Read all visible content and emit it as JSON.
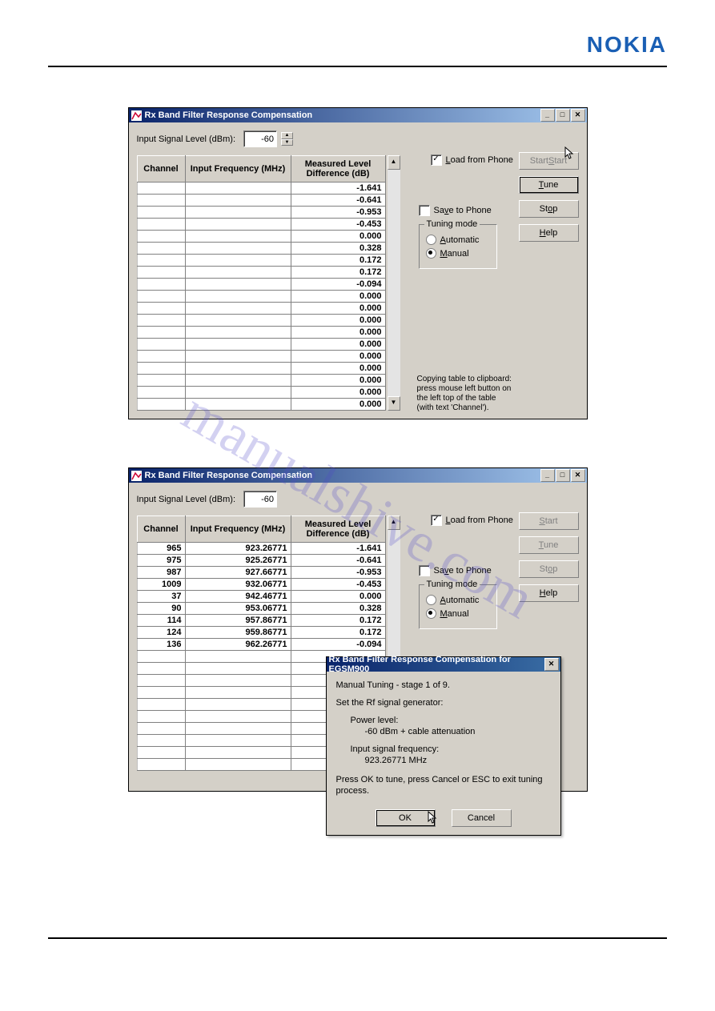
{
  "logo_text": "NOKIA",
  "watermark": "manualshive.com",
  "window_title": "Rx Band Filter Response Compensation",
  "input_signal_label": "Input Signal Level (dBm):",
  "input_signal_value": "-60",
  "cols": {
    "channel": "Channel",
    "freq": "Input Frequency (MHz)",
    "diff": "Measured Level\nDifference (dB)"
  },
  "load_label": "Load from Phone",
  "save_label": "Save to Phone",
  "load_checked": true,
  "save_checked": false,
  "tuning_legend": "Tuning mode",
  "tuning_auto": "Automatic",
  "tuning_manual": "Manual",
  "buttons": {
    "start": "Start",
    "tune": "Tune",
    "stop": "Stop",
    "help": "Help"
  },
  "copy_hint": "Copying table to clipboard: press mouse left button on the left top of the table (with text 'Channel').",
  "screenshot1_rows": [
    {
      "channel": "",
      "freq": "",
      "diff": "-1.641"
    },
    {
      "channel": "",
      "freq": "",
      "diff": "-0.641"
    },
    {
      "channel": "",
      "freq": "",
      "diff": "-0.953"
    },
    {
      "channel": "",
      "freq": "",
      "diff": "-0.453"
    },
    {
      "channel": "",
      "freq": "",
      "diff": "0.000"
    },
    {
      "channel": "",
      "freq": "",
      "diff": "0.328"
    },
    {
      "channel": "",
      "freq": "",
      "diff": "0.172"
    },
    {
      "channel": "",
      "freq": "",
      "diff": "0.172"
    },
    {
      "channel": "",
      "freq": "",
      "diff": "-0.094"
    },
    {
      "channel": "",
      "freq": "",
      "diff": "0.000"
    },
    {
      "channel": "",
      "freq": "",
      "diff": "0.000"
    },
    {
      "channel": "",
      "freq": "",
      "diff": "0.000"
    },
    {
      "channel": "",
      "freq": "",
      "diff": "0.000"
    },
    {
      "channel": "",
      "freq": "",
      "diff": "0.000"
    },
    {
      "channel": "",
      "freq": "",
      "diff": "0.000"
    },
    {
      "channel": "",
      "freq": "",
      "diff": "0.000"
    },
    {
      "channel": "",
      "freq": "",
      "diff": "0.000"
    },
    {
      "channel": "",
      "freq": "",
      "diff": "0.000"
    },
    {
      "channel": "",
      "freq": "",
      "diff": "0.000"
    }
  ],
  "screenshot2_rows": [
    {
      "channel": "965",
      "freq": "923.26771",
      "diff": "-1.641"
    },
    {
      "channel": "975",
      "freq": "925.26771",
      "diff": "-0.641"
    },
    {
      "channel": "987",
      "freq": "927.66771",
      "diff": "-0.953"
    },
    {
      "channel": "1009",
      "freq": "932.06771",
      "diff": "-0.453"
    },
    {
      "channel": "37",
      "freq": "942.46771",
      "diff": "0.000"
    },
    {
      "channel": "90",
      "freq": "953.06771",
      "diff": "0.328"
    },
    {
      "channel": "114",
      "freq": "957.86771",
      "diff": "0.172"
    },
    {
      "channel": "124",
      "freq": "959.86771",
      "diff": "0.172"
    },
    {
      "channel": "136",
      "freq": "962.26771",
      "diff": "-0.094"
    }
  ],
  "modal": {
    "title": "Rx Band Filter Response Compensation for EGSM900",
    "stage": "Manual Tuning - stage 1 of 9.",
    "set_gen": "Set the Rf signal generator:",
    "power_lbl": "Power level:",
    "power_val": "-60 dBm + cable attenuation",
    "freq_lbl": "Input signal frequency:",
    "freq_val": "923.26771 MHz",
    "instr": "Press OK to tune, press Cancel or ESC to exit tuning process.",
    "ok": "OK",
    "cancel": "Cancel"
  }
}
